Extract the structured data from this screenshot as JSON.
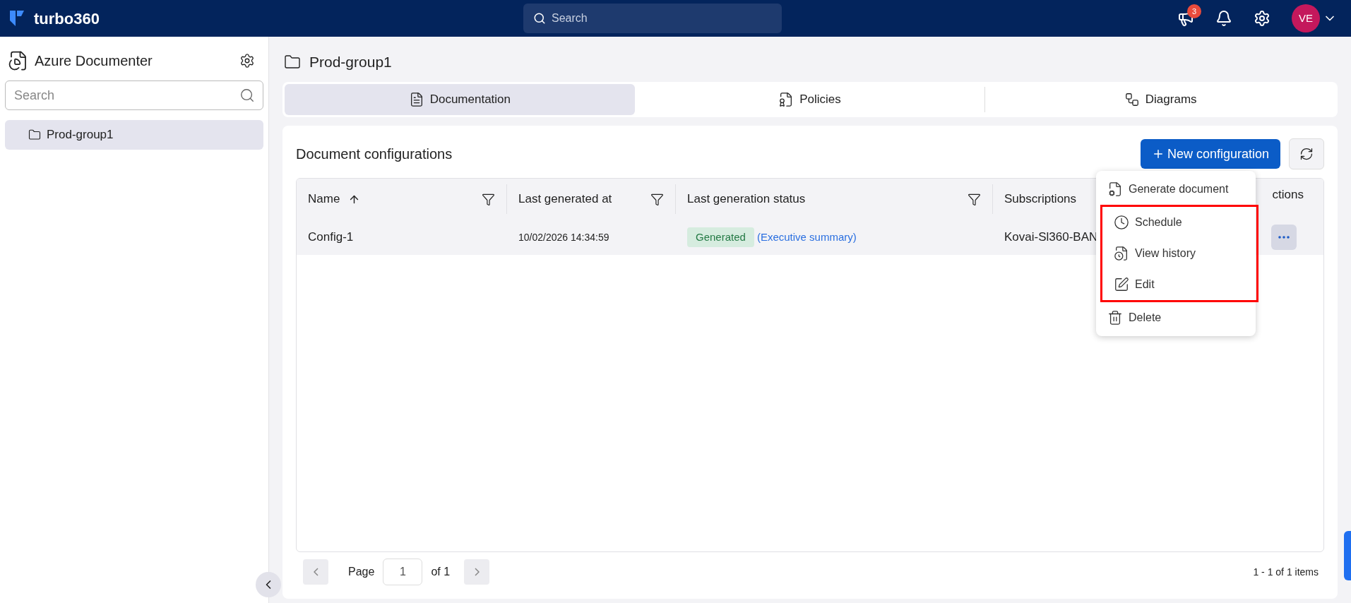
{
  "topbar": {
    "logo": "turbo360",
    "search": {
      "placeholder": "Search"
    },
    "notification_count": "3",
    "avatar": "VE"
  },
  "sidebar": {
    "title": "Azure Documenter",
    "search": {
      "placeholder": "Search"
    },
    "items": [
      {
        "label": "Prod-group1",
        "selected": true
      }
    ]
  },
  "page": {
    "title": "Prod-group1"
  },
  "tabs": [
    {
      "label": "Documentation",
      "selected": true
    },
    {
      "label": "Policies",
      "selected": false
    },
    {
      "label": "Diagrams",
      "selected": false
    }
  ],
  "card": {
    "title": "Document configurations",
    "new_button": "New configuration"
  },
  "table": {
    "columns": [
      {
        "label": "Name",
        "sorted": true,
        "filter": true
      },
      {
        "label": "Last generated at",
        "sorted": false,
        "filter": true
      },
      {
        "label": "Last generation status",
        "sorted": false,
        "filter": true
      },
      {
        "label": "Subscriptions"
      },
      {
        "label": "ctions"
      }
    ],
    "rows": [
      {
        "name": "Config-1",
        "generated_at": "10/02/2026 14:34:59",
        "status": "Generated",
        "link": "(Executive summary)",
        "subscription": "Kovai-Sl360-BAN"
      }
    ]
  },
  "menu": {
    "items": [
      {
        "label": "Generate document",
        "kind": "generate",
        "highlighted": false
      },
      {
        "label": "Schedule",
        "kind": "schedule",
        "highlighted": true
      },
      {
        "label": "View history",
        "kind": "history",
        "highlighted": true
      },
      {
        "label": "Edit",
        "kind": "edit",
        "highlighted": true
      },
      {
        "label": "Delete",
        "kind": "delete",
        "highlighted": false
      }
    ]
  },
  "pagination": {
    "page_label": "Page",
    "page": "1",
    "of": "of 1",
    "summary": "1 - 1 of 1 items"
  }
}
